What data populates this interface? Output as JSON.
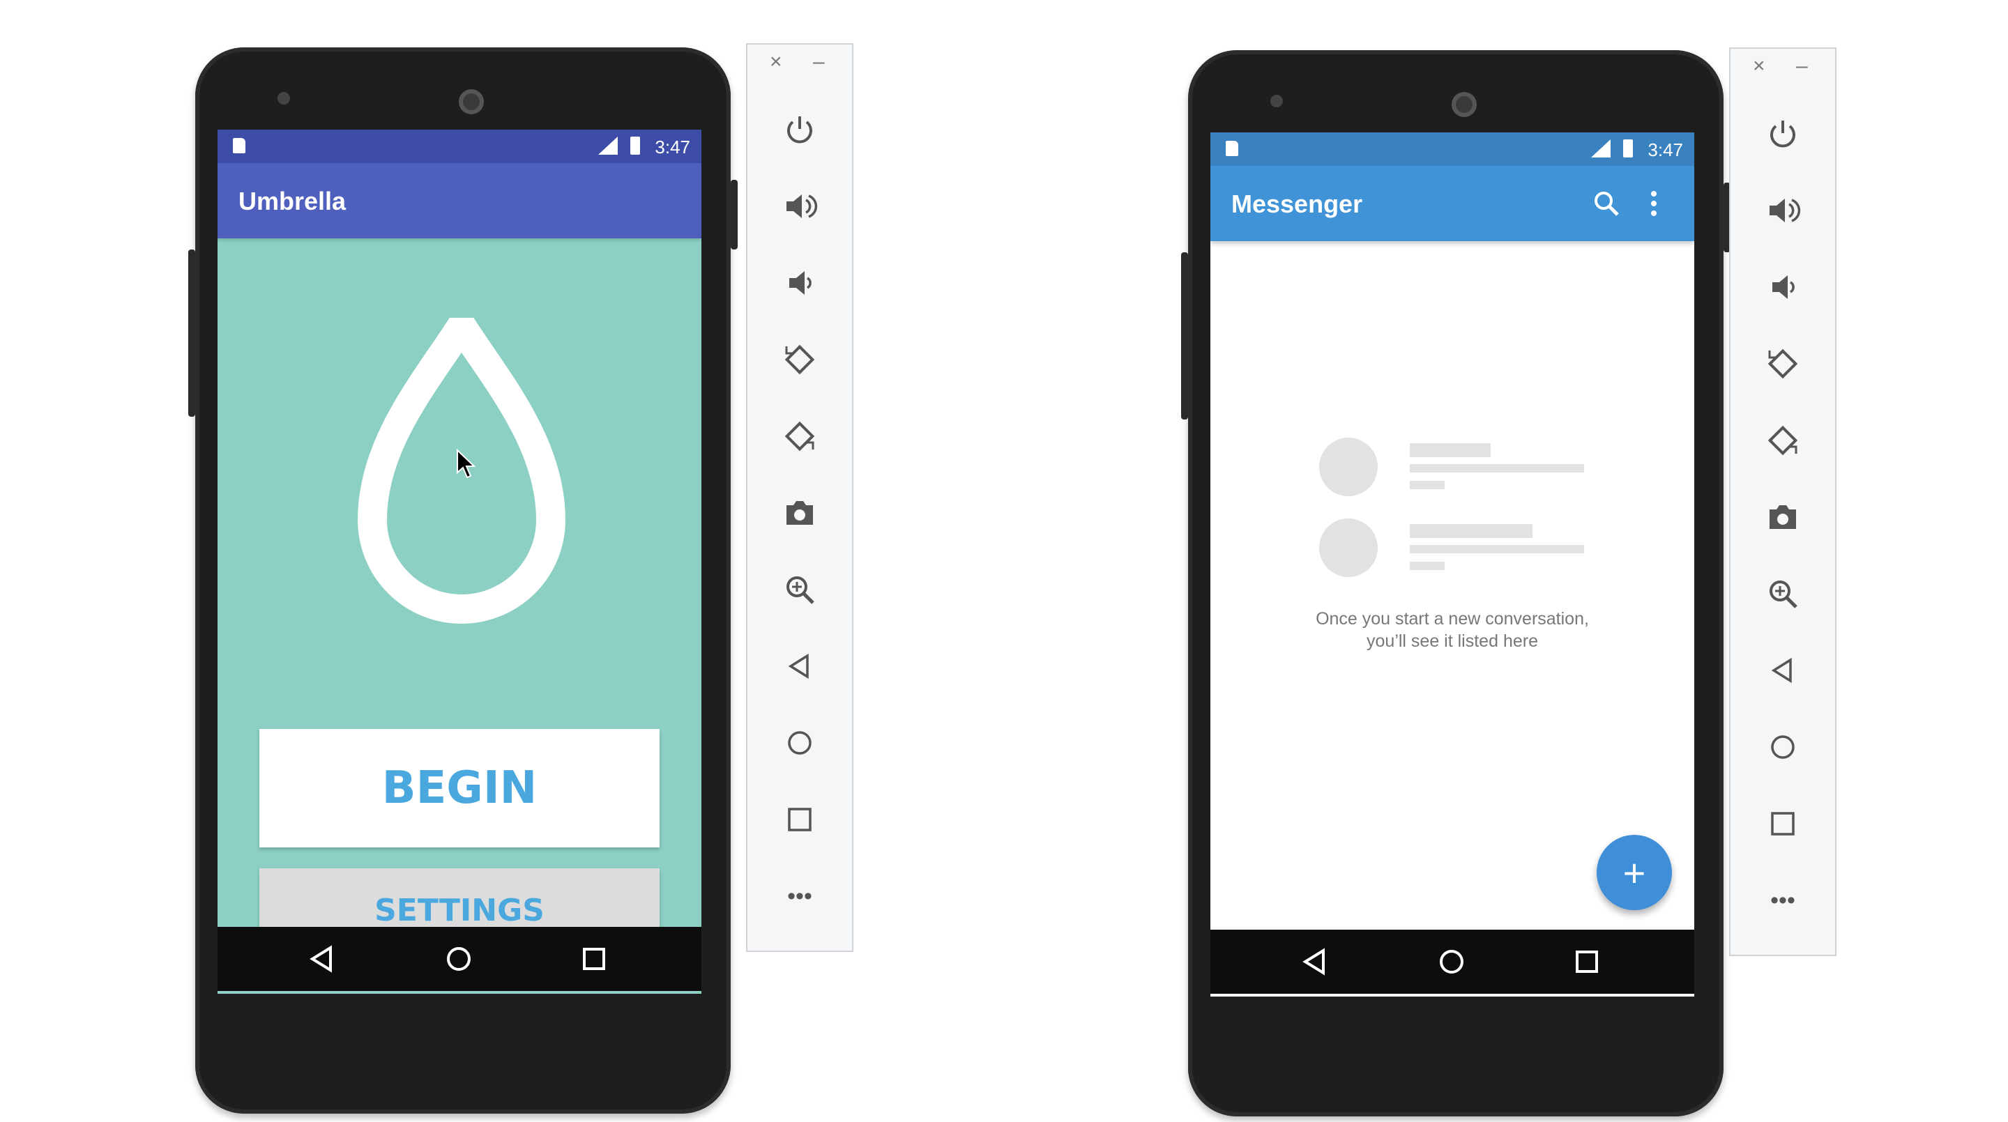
{
  "colors": {
    "umbrella_primary": "#4f5fbd",
    "umbrella_status": "#3d4ca6",
    "umbrella_background": "#8ccfc3",
    "accent_text": "#4aa8df",
    "messenger_primary": "#3f93d6",
    "messenger_status": "#3a82bf",
    "fab": "#3e8fd8"
  },
  "left_phone": {
    "status_time": "3:47",
    "app_title": "Umbrella",
    "logo_icon": "water-drop-icon",
    "begin_label": "BEGIN",
    "settings_label": "SETTINGS"
  },
  "right_phone": {
    "status_time": "3:47",
    "app_title": "Messenger",
    "search_icon": "search-icon",
    "overflow_icon": "more-vert-icon",
    "empty_line1": "Once you start a new conversation,",
    "empty_line2": "you’ll see it listed here",
    "fab_label": "+"
  },
  "toolbar": {
    "close_label": "×",
    "minimize_label": "–",
    "items": [
      "power-icon",
      "volume-up-icon",
      "volume-down-icon",
      "rotate-left-icon",
      "rotate-right-icon",
      "camera-icon",
      "zoom-icon",
      "back-icon",
      "home-icon",
      "overview-icon",
      "more-icon"
    ],
    "more_label": "•••"
  }
}
